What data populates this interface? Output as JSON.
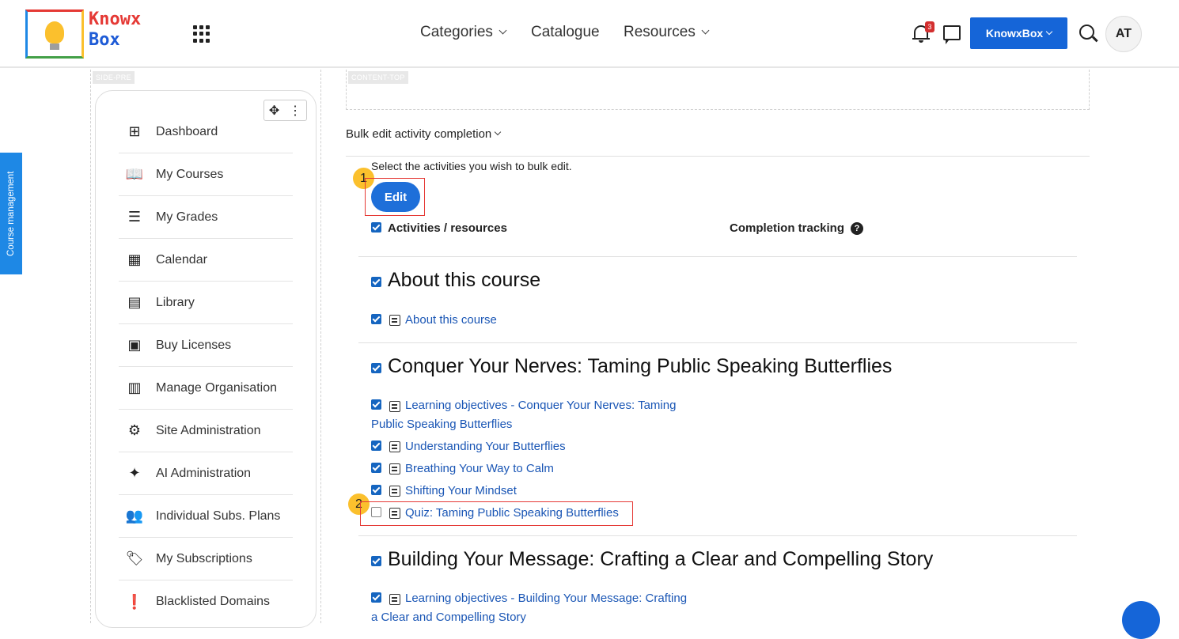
{
  "header": {
    "logo_line1": "Knowx",
    "logo_line2": "Box",
    "nav": [
      {
        "label": "Categories",
        "has_dropdown": true
      },
      {
        "label": "Catalogue",
        "has_dropdown": false
      },
      {
        "label": "Resources",
        "has_dropdown": true
      }
    ],
    "notification_count": "3",
    "account_button": "KnowxBox",
    "avatar_initials": "AT"
  },
  "side_tab": "Course management",
  "regions": {
    "side_pre": "SIDE-PRE",
    "content_top": "CONTENT-TOP"
  },
  "sidebar": {
    "items": [
      {
        "label": "Dashboard",
        "icon": "dashboard-icon"
      },
      {
        "label": "My Courses",
        "icon": "book-icon"
      },
      {
        "label": "My Grades",
        "icon": "grades-icon"
      },
      {
        "label": "Calendar",
        "icon": "calendar-icon"
      },
      {
        "label": "Library",
        "icon": "library-icon"
      },
      {
        "label": "Buy Licenses",
        "icon": "license-icon"
      },
      {
        "label": "Manage Organisation",
        "icon": "organisation-icon"
      },
      {
        "label": "Site Administration",
        "icon": "gear-icon"
      },
      {
        "label": "AI Administration",
        "icon": "sparkle-icon"
      },
      {
        "label": "Individual Subs. Plans",
        "icon": "users-icon"
      },
      {
        "label": "My Subscriptions",
        "icon": "tag-icon"
      },
      {
        "label": "Blacklisted Domains",
        "icon": "alert-icon"
      }
    ]
  },
  "main": {
    "bulk_title": "Bulk edit activity completion",
    "instruction": "Select the activities you wish to bulk edit.",
    "edit_button": "Edit",
    "callouts": [
      "1",
      "2"
    ],
    "col_activities": "Activities / resources",
    "col_completion": "Completion tracking",
    "sections": [
      {
        "title": "About this course",
        "checked": true,
        "activities": [
          {
            "label": "About this course",
            "checked": true
          }
        ]
      },
      {
        "title": "Conquer Your Nerves: Taming Public Speaking Butterflies",
        "checked": true,
        "activities": [
          {
            "label_line1": "Learning objectives - Conquer Your Nerves: Taming",
            "label_line2": "Public Speaking Butterflies",
            "checked": true
          },
          {
            "label": "Understanding Your Butterflies",
            "checked": true
          },
          {
            "label": "Breathing Your Way to Calm",
            "checked": true
          },
          {
            "label": "Shifting Your Mindset",
            "checked": true
          },
          {
            "label": "Quiz: Taming Public Speaking Butterflies",
            "checked": false
          }
        ]
      },
      {
        "title": "Building Your Message: Crafting a Clear and Compelling Story",
        "checked": true,
        "activities": [
          {
            "label_line1": "Learning objectives - Building Your Message: Crafting",
            "label_line2": "a Clear and Compelling Story",
            "checked": true
          }
        ]
      }
    ]
  }
}
